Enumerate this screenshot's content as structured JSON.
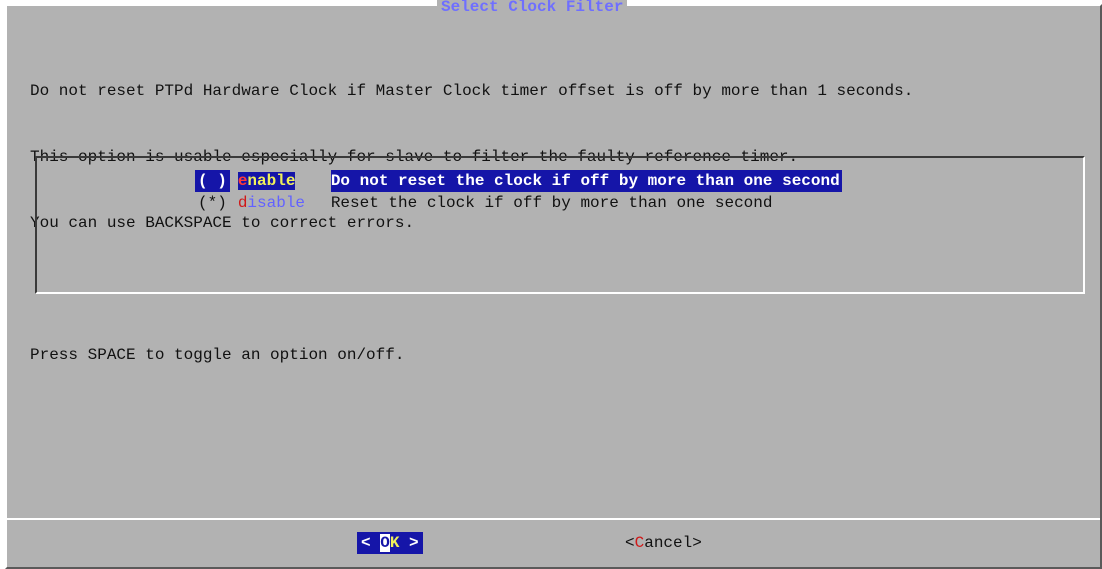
{
  "dialog": {
    "title": "Select Clock Filter",
    "message_lines": [
      "Do not reset PTPd Hardware Clock if Master Clock timer offset is off by more than 1 seconds.",
      "This option is usable especially for slave to filter the faulty reference timer.",
      "You can use BACKSPACE to correct errors.",
      "",
      "Press SPACE to toggle an option on/off."
    ]
  },
  "options": [
    {
      "radio": "( )",
      "tag_hotkey": "e",
      "tag_rest": "nable",
      "description": "Do not reset the clock if off by more than one second",
      "highlighted": true
    },
    {
      "radio": "(*)",
      "tag_hotkey": "d",
      "tag_rest": "isable",
      "description": "Reset the clock if off by more than one second",
      "highlighted": false
    }
  ],
  "buttons": {
    "ok": {
      "left": "< ",
      "hotkey": "O",
      "rest": "K",
      "right": " >"
    },
    "cancel": {
      "left": "<",
      "hotkey": "C",
      "rest": "ancel",
      "right": ">"
    }
  },
  "colors": {
    "dialog_bg": "#b2b2b2",
    "highlight_bg": "#1515a8",
    "title_fg": "#6f6fff",
    "hotkey_fg": "#d01818",
    "selected_tag_fg": "#f0f05a"
  }
}
